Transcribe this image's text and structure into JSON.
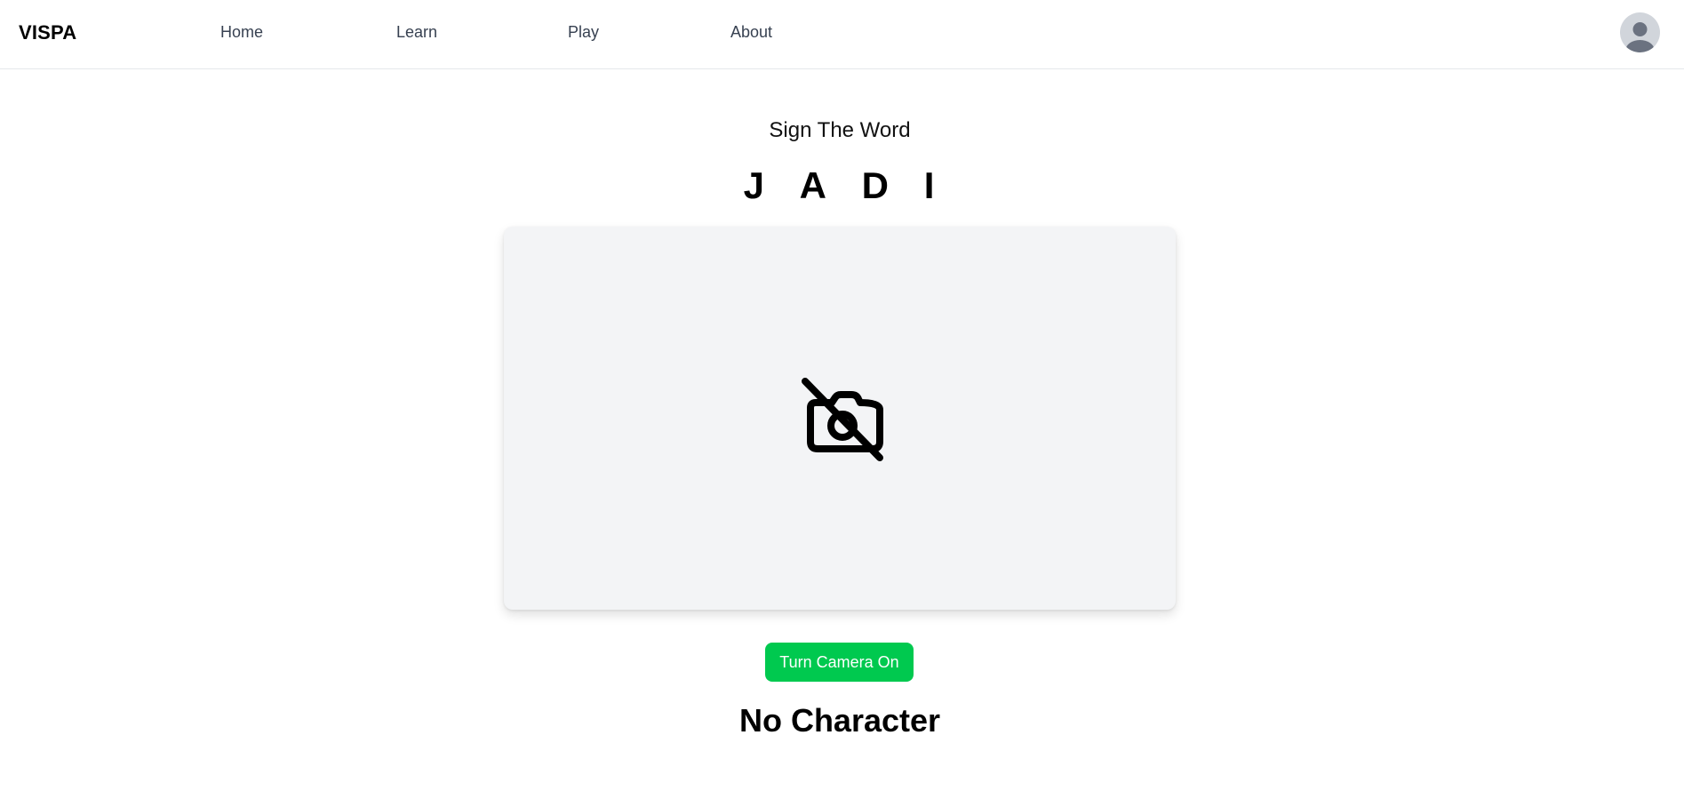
{
  "navbar": {
    "brand": "VISPA",
    "links": [
      {
        "label": "Home"
      },
      {
        "label": "Learn"
      },
      {
        "label": "Play"
      },
      {
        "label": "About"
      }
    ],
    "avatar_icon": "user-avatar-icon"
  },
  "main": {
    "subtitle": "Sign The Word",
    "word_letters": [
      "J",
      "A",
      "D",
      "I"
    ],
    "camera_placeholder_icon": "camera-off-icon",
    "camera_button_label": "Turn Camera On",
    "status_text": "No Character"
  },
  "colors": {
    "accent": "#00c94f",
    "camera_bg": "#f3f4f6",
    "nav_text": "#374151",
    "avatar_bg": "#d1d5db",
    "avatar_fg": "#6b7280"
  }
}
